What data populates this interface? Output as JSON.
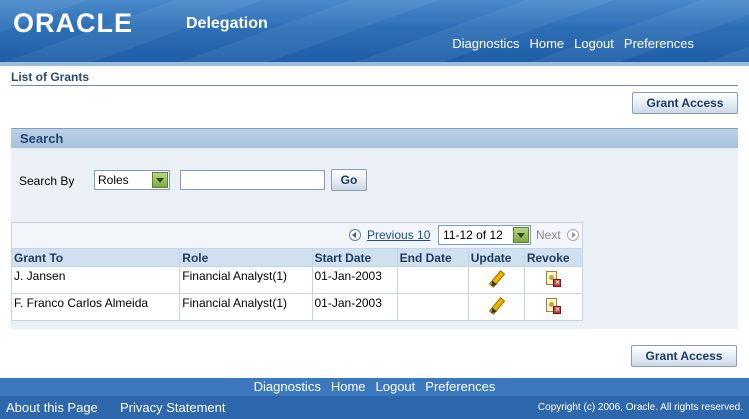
{
  "header": {
    "logo_text": "ORACLE",
    "app_title": "Delegation",
    "global_links": [
      "Diagnostics",
      "Home",
      "Logout",
      "Preferences"
    ]
  },
  "page": {
    "title": "List of Grants",
    "grant_access_label": "Grant Access"
  },
  "search": {
    "section_title": "Search",
    "search_by_label": "Search By",
    "search_by_value": "Roles",
    "search_value": "",
    "go_label": "Go"
  },
  "table": {
    "nav": {
      "previous_label": "Previous 10",
      "range_value": "11-12 of 12",
      "next_label": "Next"
    },
    "columns": [
      "Grant To",
      "Role",
      "Start Date",
      "End Date",
      "Update",
      "Revoke"
    ],
    "rows": [
      {
        "grant_to": "J. Jansen",
        "role": "Financial Analyst(1)",
        "start_date": "01-Jan-2003",
        "end_date": ""
      },
      {
        "grant_to": "F. Franco Carlos Almeida",
        "role": "Financial Analyst(1)",
        "start_date": "01-Jan-2003",
        "end_date": ""
      }
    ]
  },
  "footer": {
    "links": [
      "Diagnostics",
      "Home",
      "Logout",
      "Preferences"
    ],
    "about": "About this Page",
    "privacy": "Privacy Statement",
    "copyright": "Copyright (c) 2006, Oracle. All rights reserved."
  }
}
